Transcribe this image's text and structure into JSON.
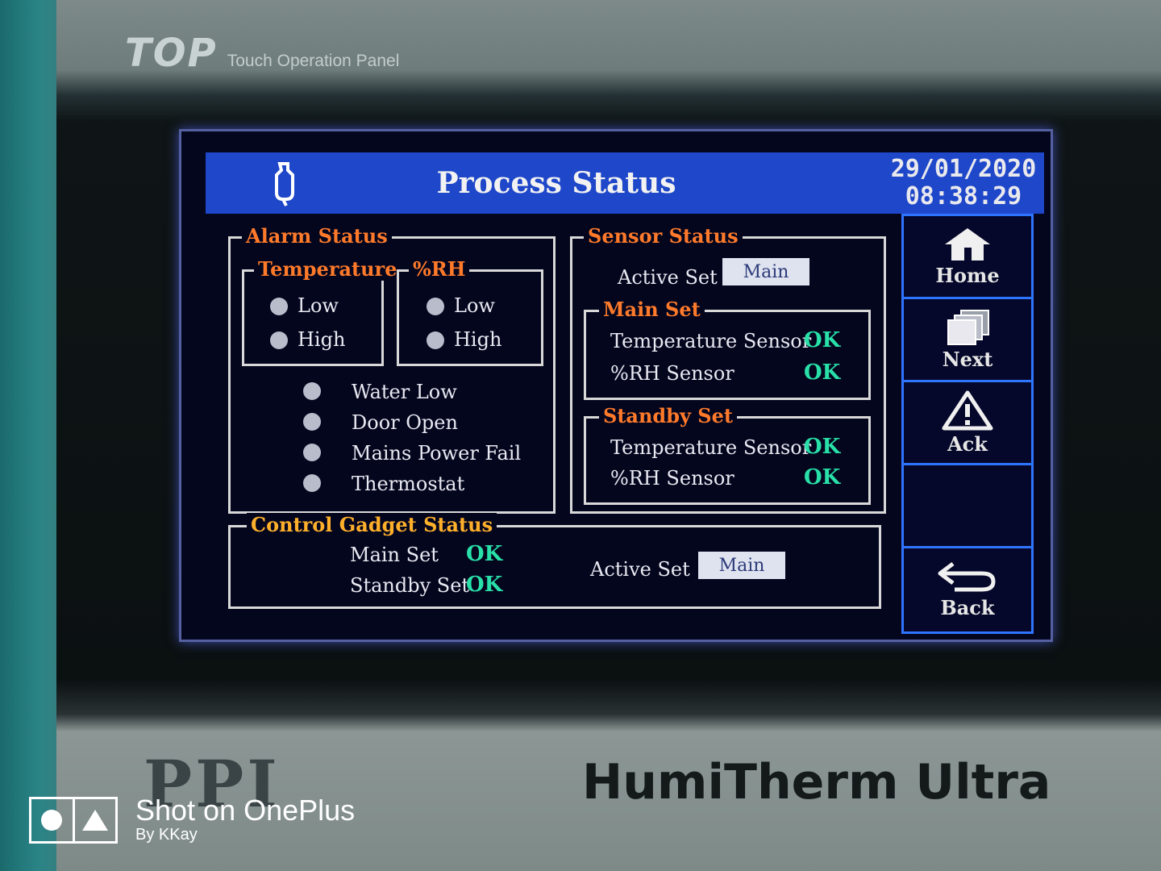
{
  "device": {
    "brand_logo": "TOP",
    "brand_subtitle": "Touch Operation Panel",
    "manufacturer": "PPI",
    "model": "HumiTherm Ultra"
  },
  "header": {
    "title": "Process Status",
    "date": "29/01/2020",
    "time": "08:38:29"
  },
  "alarm_status": {
    "title": "Alarm Status",
    "temperature": {
      "title": "Temperature",
      "low": "Low",
      "high": "High"
    },
    "rh": {
      "title": "%RH",
      "low": "Low",
      "high": "High"
    },
    "items": [
      "Water Low",
      "Door Open",
      "Mains Power Fail",
      "Thermostat"
    ]
  },
  "sensor_status": {
    "title": "Sensor Status",
    "active_set_label": "Active Set",
    "active_set_value": "Main",
    "main_set": {
      "title": "Main Set",
      "temp_label": "Temperature Sensor",
      "temp_value": "OK",
      "rh_label": "%RH Sensor",
      "rh_value": "OK"
    },
    "standby_set": {
      "title": "Standby Set",
      "temp_label": "Temperature Sensor",
      "temp_value": "OK",
      "rh_label": "%RH Sensor",
      "rh_value": "OK"
    }
  },
  "control_gadget": {
    "title": "Control Gadget Status",
    "main_label": "Main Set",
    "main_value": "OK",
    "standby_label": "Standby Set",
    "standby_value": "OK",
    "active_set_label": "Active Set",
    "active_set_value": "Main"
  },
  "nav": {
    "home": "Home",
    "next": "Next",
    "ack": "Ack",
    "back": "Back"
  },
  "watermark": {
    "main": "Shot on OnePlus",
    "sub": "By KKay"
  },
  "colors": {
    "header_blue": "#1f47c9",
    "legend_orange": "#ff7a2a",
    "ok_green": "#28e0a8",
    "nav_border": "#2f74ff"
  }
}
